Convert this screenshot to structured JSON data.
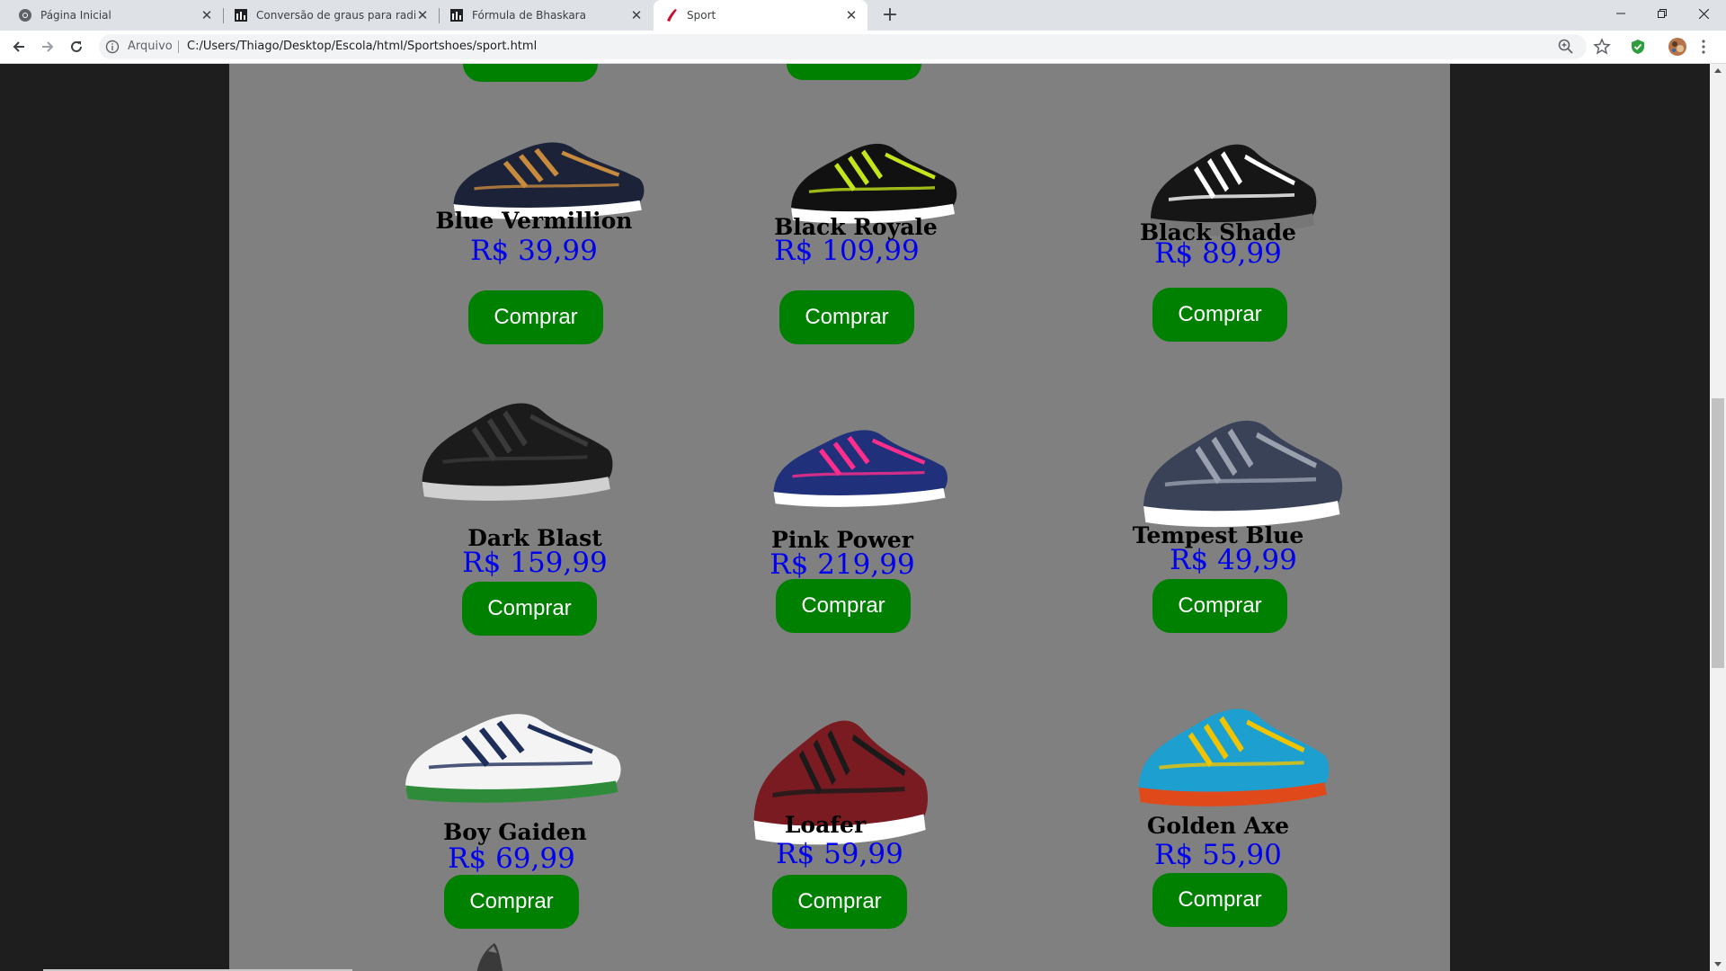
{
  "browser": {
    "tabs": [
      {
        "title": "Página Inicial",
        "icon": "chrome-icon"
      },
      {
        "title": "Conversão de graus para radiano",
        "icon": "web-icon"
      },
      {
        "title": "Fórmula de Bhaskara",
        "icon": "web-icon"
      },
      {
        "title": "Sport",
        "icon": "shoe-icon",
        "active": true
      }
    ],
    "omnibox_label": "Arquivo",
    "url": "C:/Users/Thiago/Desktop/Escola/html/Sportshoes/sport.html"
  },
  "store": {
    "buy_label": "Comprar",
    "products": [
      {
        "name": "Blue Vermillion",
        "price": "R$ 39,99",
        "colors": [
          "#1c2338",
          "#c88a3c",
          "#ffffff"
        ]
      },
      {
        "name": "Black Royale",
        "price": "R$ 109,99",
        "colors": [
          "#111111",
          "#c6e41a",
          "#ffffff"
        ]
      },
      {
        "name": "Black Shade",
        "price": "R$ 89,99",
        "colors": [
          "#161616",
          "#ffffff",
          "#777777"
        ]
      },
      {
        "name": "Dark Blast",
        "price": "R$ 159,99",
        "colors": [
          "#1b1b1b",
          "#3a3a3a",
          "#d0d0d0"
        ]
      },
      {
        "name": "Pink Power",
        "price": "R$ 219,99",
        "colors": [
          "#20307a",
          "#ff2e8c",
          "#ffffff"
        ]
      },
      {
        "name": "Tempest Blue",
        "price": "R$ 49,99",
        "colors": [
          "#3a4258",
          "#9aa0ae",
          "#ffffff"
        ]
      },
      {
        "name": "Boy Gaiden",
        "price": "R$ 69,99",
        "colors": [
          "#f4f4f4",
          "#1e2e5a",
          "#2e8b3a"
        ]
      },
      {
        "name": "Loafer",
        "price": "R$ 59,99",
        "colors": [
          "#7a1b22",
          "#1a1a1a",
          "#ffffff"
        ]
      },
      {
        "name": "Golden Axe",
        "price": "R$ 55,90",
        "colors": [
          "#1da0cf",
          "#f0c400",
          "#e04a1a"
        ]
      }
    ]
  },
  "theme": {
    "page_bg": "#808080",
    "button_bg": "#008000",
    "price_color": "#0000ee"
  }
}
